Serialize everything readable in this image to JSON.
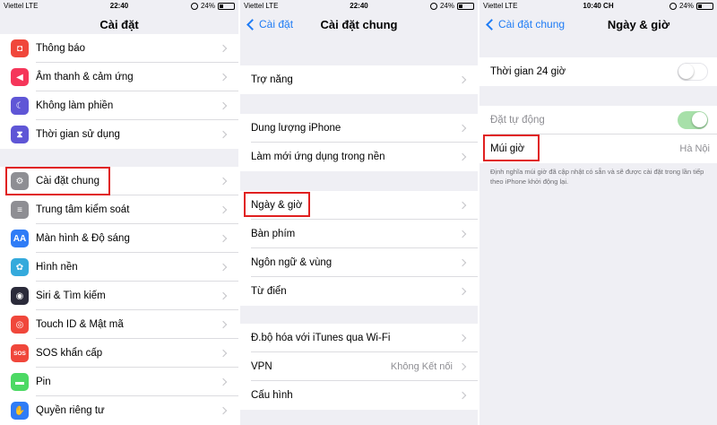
{
  "status": {
    "carrier": "Viettel",
    "network": "LTE",
    "battery": "24%"
  },
  "panel1": {
    "time": "22:40",
    "title": "Cài đặt",
    "items": [
      {
        "label": "Thông báo",
        "icon": "bell-icon",
        "color": "#f0473b",
        "glyph": "◘"
      },
      {
        "label": "Âm thanh & cảm ứng",
        "icon": "speaker-icon",
        "color": "#f5365a",
        "glyph": "◀"
      },
      {
        "label": "Không làm phiền",
        "icon": "moon-icon",
        "color": "#5f56d6",
        "glyph": "☾"
      },
      {
        "label": "Thời gian sử dụng",
        "icon": "hourglass-icon",
        "color": "#5f56d6",
        "glyph": "⧗"
      },
      {
        "label": "Cài đặt chung",
        "icon": "gear-icon",
        "color": "#8e8e93",
        "glyph": "⚙"
      },
      {
        "label": "Trung tâm kiểm soát",
        "icon": "toggles-icon",
        "color": "#8e8e93",
        "glyph": "≡"
      },
      {
        "label": "Màn hình & Độ sáng",
        "icon": "display-icon",
        "color": "#2f7cf6",
        "glyph": "AA"
      },
      {
        "label": "Hình nền",
        "icon": "wallpaper-icon",
        "color": "#34aadc",
        "glyph": "✿"
      },
      {
        "label": "Siri & Tìm kiếm",
        "icon": "siri-icon",
        "color": "#2b2b3a",
        "glyph": "◉"
      },
      {
        "label": "Touch ID & Mật mã",
        "icon": "fingerprint-icon",
        "color": "#f0473b",
        "glyph": "◎"
      },
      {
        "label": "SOS khẩn cấp",
        "icon": "sos-icon",
        "color": "#f0473b",
        "glyph": "SOS"
      },
      {
        "label": "Pin",
        "icon": "battery-icon",
        "color": "#4cd964",
        "glyph": "▬"
      },
      {
        "label": "Quyền riêng tư",
        "icon": "hand-icon",
        "color": "#2f7cf6",
        "glyph": "✋"
      }
    ]
  },
  "panel2": {
    "time": "22:40",
    "back": "Cài đặt",
    "title": "Cài đặt chung",
    "items": [
      {
        "label": "Trợ năng"
      },
      {
        "label": "Dung lượng iPhone"
      },
      {
        "label": "Làm mới ứng dụng trong nền"
      },
      {
        "label": "Ngày & giờ"
      },
      {
        "label": "Bàn phím"
      },
      {
        "label": "Ngôn ngữ & vùng"
      },
      {
        "label": "Từ điển"
      },
      {
        "label": "Đ.bộ hóa với iTunes qua Wi-Fi"
      },
      {
        "label": "VPN",
        "value": "Không Kết nối"
      },
      {
        "label": "Cấu hình"
      }
    ]
  },
  "panel3": {
    "time": "10:40 CH",
    "back": "Cài đặt chung",
    "title": "Ngày & giờ",
    "time24": {
      "label": "Thời gian 24 giờ",
      "on": false
    },
    "auto": {
      "label": "Đặt tự động",
      "on": true
    },
    "timezone": {
      "label": "Múi giờ",
      "value": "Hà Nội"
    },
    "footnote": "Định nghĩa múi giờ đã cập nhật có sẵn và sẽ được cài đặt trong lần tiếp theo iPhone khởi động lại."
  },
  "colors": {
    "accent": "#1f7cf5",
    "highlight": "#e02020",
    "toggle_on": "#a7e0a9"
  }
}
